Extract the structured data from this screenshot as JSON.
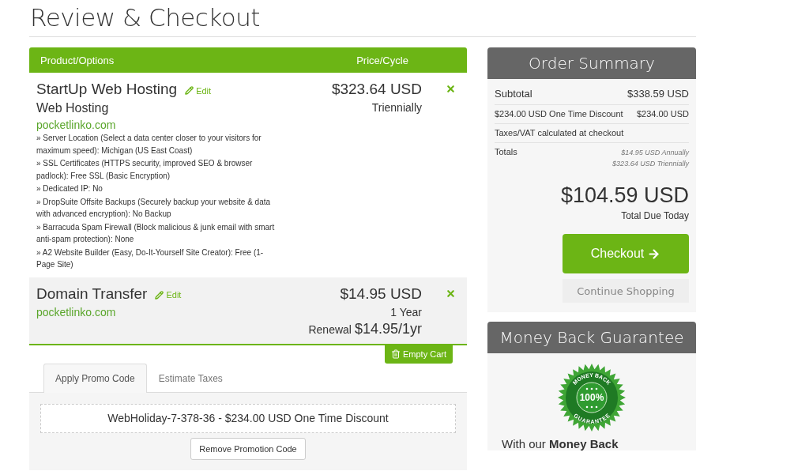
{
  "page_title": "Review & Checkout",
  "cart": {
    "columns": [
      "Product/Options",
      "Price/Cycle"
    ],
    "items": [
      {
        "name": "StartUp Web Hosting",
        "edit": "Edit",
        "group": "Web Hosting",
        "domain": "pocketlinko.com",
        "options": [
          "» Server Location (Select a data center closer to your visitors for maximum speed): Michigan (US East Coast)",
          "» SSL Certificates (HTTPS security, improved SEO & browser padlock): Free SSL (Basic Encryption)",
          "» Dedicated IP: No",
          "» DropSuite Offsite Backups (Securely backup your website & data with advanced encryption): No Backup",
          "» Barracuda Spam Firewall (Block malicious & junk email with smart anti-spam protection): None",
          "» A2 Website Builder (Easy, Do-It-Yourself Site Creator): Free (1-Page Site)"
        ],
        "price": "$323.64 USD",
        "cycle": "Triennially"
      },
      {
        "name": "Domain Transfer",
        "edit": "Edit",
        "domain": "pocketlinko.com",
        "price": "$14.95 USD",
        "cycle": "1 Year",
        "renewal_label": "Renewal",
        "renewal_price": "$14.95/1yr"
      }
    ],
    "empty_cart": "Empty Cart"
  },
  "tabs": [
    {
      "label": "Apply Promo Code",
      "selected": true
    },
    {
      "label": "Estimate Taxes",
      "selected": false
    }
  ],
  "promo": {
    "applied": "WebHoliday-7-378-36 - $234.00 USD One Time Discount",
    "remove_button": "Remove Promotion Code"
  },
  "order_summary": {
    "title": "Order Summary",
    "rows": [
      {
        "kind": "main",
        "label": "Subtotal",
        "value": "$338.59 USD"
      },
      {
        "kind": "minor",
        "label": "$234.00 USD One Time Discount",
        "value": "$234.00 USD"
      },
      {
        "kind": "minor",
        "label": "Taxes/VAT calculated at checkout"
      }
    ],
    "totals_label": "Totals",
    "recurring": [
      "$14.95 USD Annually",
      "$323.64 USD Triennially"
    ],
    "total": "$104.59 USD",
    "total_caption": "Total Due Today",
    "checkout_button": "Checkout",
    "continue_button": "Continue Shopping"
  },
  "guarantee": {
    "title": "Money Back Guarantee",
    "seal": {
      "top": "MONEY BACK",
      "center": "100%",
      "bottom": "GUARANTEE"
    },
    "intro": "With our **Money Back**"
  }
}
